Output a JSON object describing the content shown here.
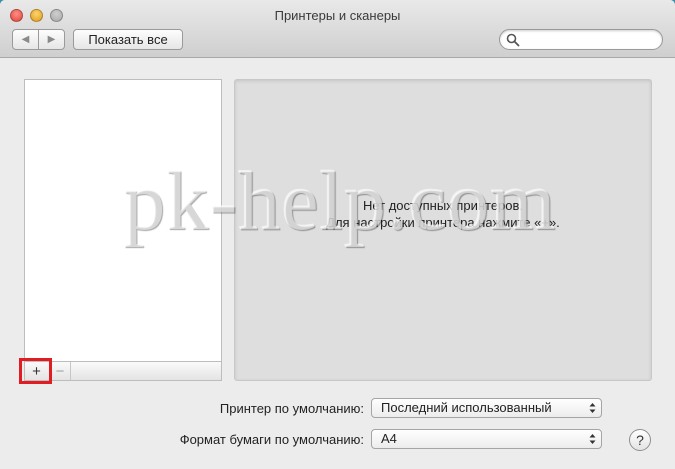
{
  "window": {
    "title": "Принтеры и сканеры"
  },
  "toolbar": {
    "back_glyph": "◀",
    "forward_glyph": "▶",
    "show_all_label": "Показать все",
    "search_value": "",
    "search_icon": "search-icon"
  },
  "printer_list": {
    "items": [],
    "add_label": "+",
    "remove_label": "−"
  },
  "detail": {
    "message_line1": "Нет доступных принтеров.",
    "message_line2": "Для настройки принтера нажмите «+»."
  },
  "watermark": "pk-help.com",
  "settings": {
    "default_printer_label": "Принтер по умолчанию:",
    "default_printer_value": "Последний использованный",
    "paper_size_label": "Формат бумаги по умолчанию:",
    "paper_size_value": "A4"
  },
  "help_label": "?"
}
